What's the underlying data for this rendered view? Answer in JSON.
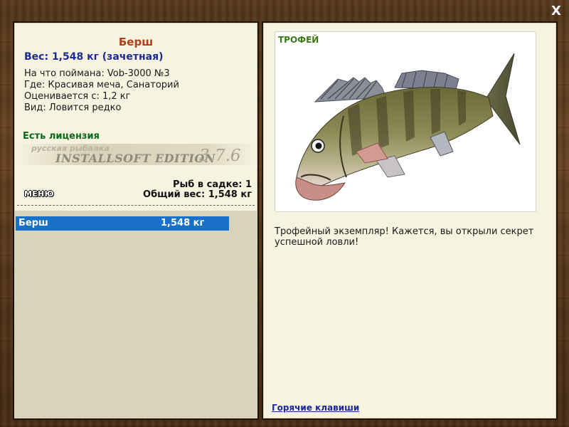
{
  "window": {
    "close_label": "X"
  },
  "fish": {
    "name": "Берш",
    "weight_line": "Вес: 1,548 кг (зачетная)",
    "caught_on": "На что поймана: Vob-3000 №3",
    "location": "Где: Красивая меча, Санаторий",
    "valued_from": "Оценивается с: 1,2 кг",
    "rarity": "Вид: Ловится редко",
    "license": "Есть лицензия"
  },
  "watermark": {
    "line1": "русская рыбалка",
    "line2": "INSTALLSOFT EDITION",
    "version": "3.7.6"
  },
  "keepnet": {
    "count_line": "Рыб в садке: 1",
    "total_line": "Общий вес: 1,548 кг",
    "menu_label": "МЕНЮ",
    "rows": [
      {
        "name": "Берш",
        "weight": "1,548 кг",
        "selected": true
      }
    ]
  },
  "trophy": {
    "label": "ТРОФЕЙ",
    "image": "zander-fish-photo",
    "description": "Трофейный экземпляр! Кажется, вы открыли секрет успешной ловли!",
    "hotkeys_link": "Горячие клавиши"
  },
  "colors": {
    "title": "#b0411a",
    "weight": "#1f2a9a",
    "license": "#0b6a17",
    "selection": "#1870c8",
    "trophy_label": "#3a7a16",
    "panel": "#f6f3e0"
  }
}
